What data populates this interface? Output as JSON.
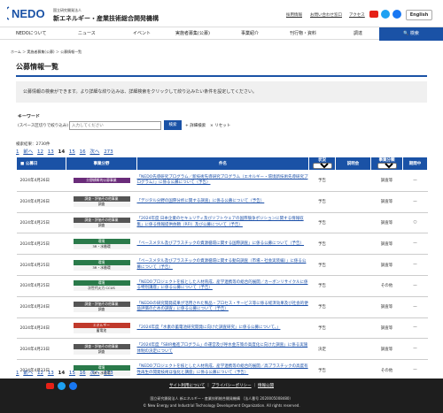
{
  "header": {
    "logo_text": "NEDO",
    "org_sub": "国立研究開発法人",
    "org_name": "新エネルギー・産業技術総合開発機構",
    "util_links": [
      "採用情報",
      "お問い合わせ窓口",
      "アクセス"
    ],
    "english_label": "English",
    "sns": [
      "youtube-icon",
      "twitter-x-icon",
      "facebook-icon"
    ],
    "brand_color": "#1a52a6"
  },
  "nav": {
    "items": [
      "NEDOについて",
      "ニュース",
      "イベント",
      "実施者募集(公募)",
      "事業紹介",
      "刊行物・資料",
      "調達"
    ],
    "search_label": "検索"
  },
  "breadcrumb": "ホーム ＞ 実施者募集(公募) ＞ 公募情報一覧",
  "page_title": "公募情報一覧",
  "intro": "公募情報の検索ができます。より詳細な絞り込みは、詳細検索をクリックして絞り込みたい条件を設定してください。",
  "search": {
    "label": "キーワード",
    "sub_label": "(スペース区切りで絞り込み)",
    "placeholder": "入力してください",
    "button": "検索",
    "detail_link": "詳細検索",
    "reset_link": "リセット"
  },
  "result_count": "検索結果：2730件",
  "pager": {
    "items": [
      "1",
      "前へ",
      "12",
      "13",
      "14",
      "15",
      "16",
      "次へ",
      "273"
    ],
    "current": "14"
  },
  "table": {
    "headers": {
      "date": "公募日",
      "category": "事業分野",
      "name": "件名",
      "status": "状況",
      "status_select": "すべて",
      "presentation": "説明会",
      "type": "事業分類",
      "type_select": "すべて",
      "resume": "期間中"
    },
    "rows": [
      {
        "date": "2024年4月26日",
        "cat_top": "分野横断的公募事業",
        "cat_bot": "",
        "cat_color": "#6a2c7a",
        "name": "「NEDO先導研究プログラム／新技術先導研究プログラム（エネルギー・環境新技術先導研究プログラム）」に係る公募について（予告）",
        "status": "予告",
        "type": "調査等",
        "resume": "—"
      },
      {
        "date": "2024年4月26日",
        "cat_top": "調査・評価その他事業",
        "cat_bot": "調査",
        "cat_color": "#555555",
        "name": "「デジタル分野の国際分析に関する調査」に係る公募について（予告）",
        "status": "予告",
        "type": "調査等",
        "resume": "—"
      },
      {
        "date": "2024年4月25日",
        "cat_top": "調査・評価その他事業",
        "cat_bot": "調査",
        "cat_color": "#555555",
        "name": "「2024年度 日本企業のセキュリティ及びソフトウェアの国際競争ポジションに関する情報収集」に係る情報提供依頼（RFI）及び公募について（予告）",
        "status": "予告",
        "type": "調査等",
        "resume": "○"
      },
      {
        "date": "2024年4月25日",
        "cat_top": "環境",
        "cat_bot": "3R・水循環",
        "cat_color": "#2a7a4a",
        "name": "「ベースメタル及びプラスチックの資源循環に関する国際調査」に係る公募について（予告）",
        "status": "予告",
        "type": "調査等",
        "resume": "—"
      },
      {
        "date": "2024年4月25日",
        "cat_top": "環境",
        "cat_bot": "3R・水循環",
        "cat_color": "#2a7a4a",
        "name": "「ベースメタル及びプラスチックの資源循環に関する動向調査（市場・社会実装編）」に係る公募について（予告）",
        "status": "予告",
        "type": "調査等",
        "resume": "—"
      },
      {
        "date": "2024年4月25日",
        "cat_top": "環境",
        "cat_bot": "次世代火力 CCUS",
        "cat_color": "#2a7a4a",
        "name": "「NEDOプロジェクトを核とした人材育成、産学連携等の総合的展開／カーボンリサイクルに係る特別講座」に係る公募について（予告）",
        "status": "予告",
        "type": "その他",
        "resume": "—"
      },
      {
        "date": "2024年4月24日",
        "cat_top": "調査・評価その他事業",
        "cat_bot": "調査",
        "cat_color": "#555555",
        "name": "「NEDOの研究開発成果が活用された製品・プロセス・サービス等に係る経済効果及び社会的便益評価のための調査」に係る公募について（予告）",
        "status": "予告",
        "type": "調査等",
        "resume": "—"
      },
      {
        "date": "2024年4月24日",
        "cat_top": "エネルギー",
        "cat_bot": "蓄電池",
        "cat_color": "#c0392b",
        "name": "「2024年度「水素の蓄電池研究開発に向けた調査研究」に係る公募について。」",
        "status": "予告",
        "type": "調査等",
        "resume": "—"
      },
      {
        "date": "2024年4月23日",
        "cat_top": "調査・評価その他事業",
        "cat_bot": "調査",
        "cat_color": "#555555",
        "name": "「2024年度「SBIR推進プログラム」の運営及び呼水金方策の高度化に向けた調査」に係る実施体制の決定について",
        "status": "決定",
        "type": "調査等",
        "resume": "—"
      },
      {
        "date": "2024年4月23日",
        "cat_top": "環境",
        "cat_bot": "3R・水循環",
        "cat_color": "#2a7a4a",
        "name": "「NEDOプロジェクトを核とした人材育成、産学連携等の総合的展開／高プラスチックの高度有性再生の開発技術ほ強化と講座」に係る公募について（予告）",
        "status": "予告",
        "type": "その他",
        "resume": "—"
      }
    ]
  },
  "footer": {
    "links": [
      "サイト利用について",
      "プライバシーポリシー",
      "情報公開"
    ],
    "address": "国立研究開発法人 新エネルギー・産業技術総合開発機構 （法人番号 2020005008480）",
    "copyright": "© New Energy and Industrial Technology Development Organization. All rights reserved."
  }
}
